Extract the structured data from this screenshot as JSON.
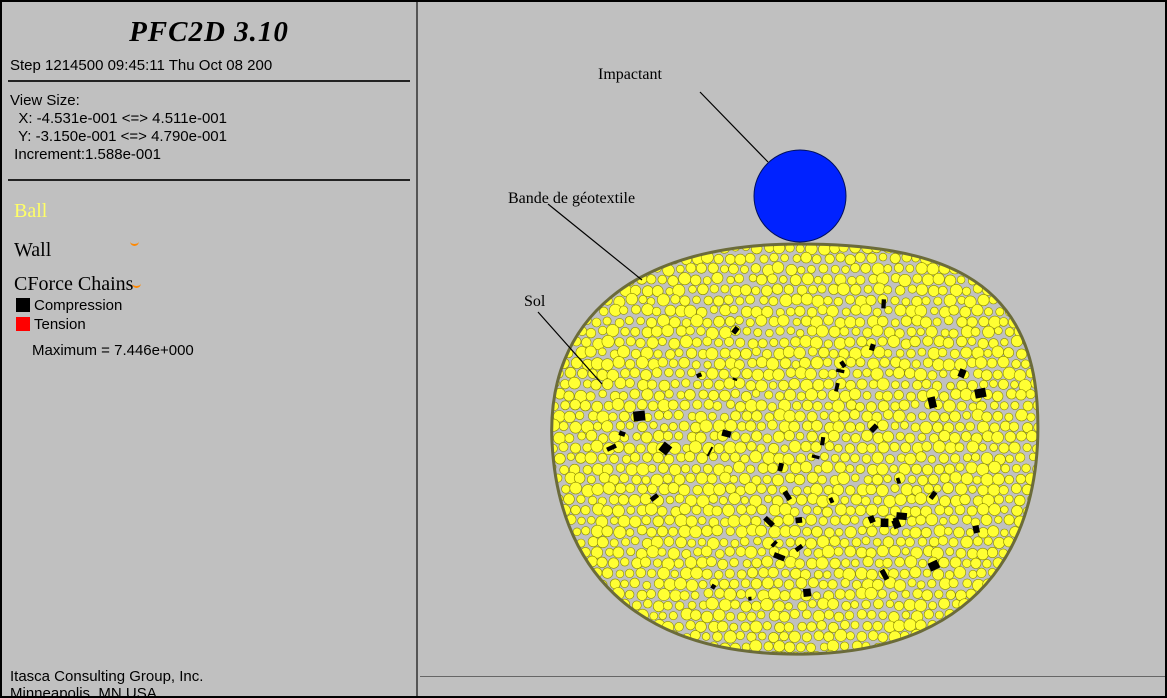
{
  "header": {
    "app_title": "PFC2D 3.10",
    "step_line": "Step 1214500  09:45:11 Thu Oct 08 200"
  },
  "view_size": {
    "label": "View Size:",
    "x_range": "  X: -4.531e-001 <=> 4.511e-001",
    "y_range": "  Y: -3.150e-001 <=> 4.790e-001",
    "increment": " Increment:1.588e-001"
  },
  "legend": {
    "ball": "Ball",
    "wall": "Wall",
    "cforce": "CForce Chains",
    "compression": "Compression",
    "tension": "Tension",
    "maximum": "Maximum =  7.446e+000"
  },
  "footer": {
    "line1": "Itasca Consulting Group, Inc.",
    "line2": "Minneapolis, MN  USA"
  },
  "annotations": {
    "impactant": "Impactant",
    "geotextile": "Bande de géotextile",
    "sol": "Sol"
  },
  "colors": {
    "background": "#c0c0c0",
    "ball_fill": "#ffff33",
    "ball_stroke": "#8a8a00",
    "impactor": "#0022ff",
    "compression": "#000000",
    "tension": "#ff0000",
    "ball_label": "#ffff66"
  }
}
